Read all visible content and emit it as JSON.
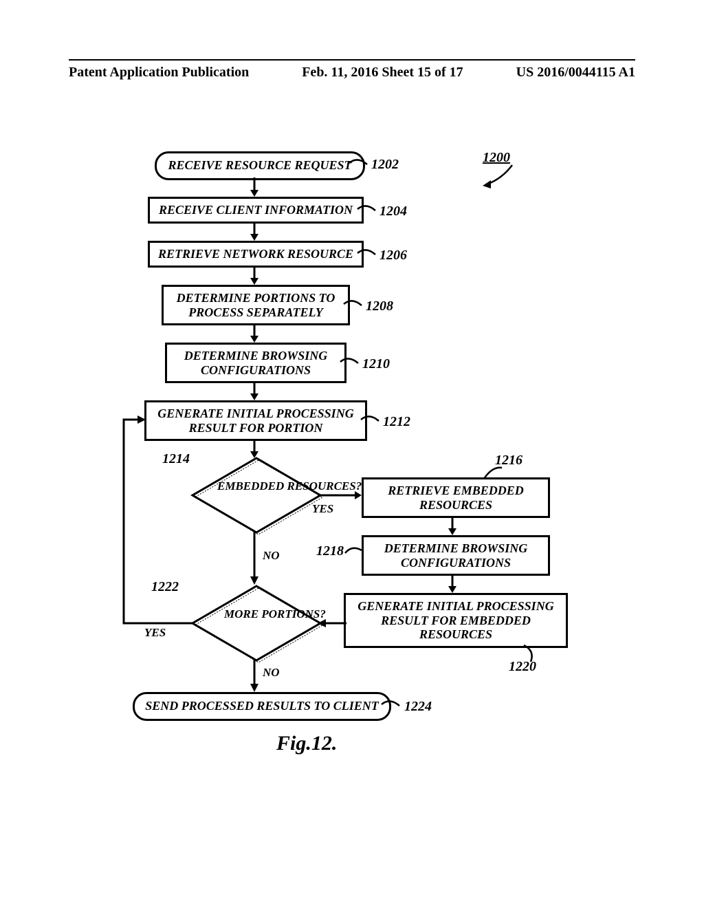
{
  "header": {
    "left": "Patent Application Publication",
    "center": "Feb. 11, 2016  Sheet 15 of 17",
    "right": "US 2016/0044115 A1"
  },
  "figure_label": "Fig.12.",
  "overall_ref": "1200",
  "steps": {
    "s1202": "RECEIVE RESOURCE REQUEST",
    "s1204": "RECEIVE CLIENT INFORMATION",
    "s1206": "RETRIEVE NETWORK RESOURCE",
    "s1208": "DETERMINE PORTIONS TO PROCESS SEPARATELY",
    "s1210": "DETERMINE BROWSING CONFIGURATIONS",
    "s1212": "GENERATE INITIAL PROCESSING RESULT FOR PORTION",
    "d1214": "EMBEDDED RESOURCES?",
    "s1216": "RETRIEVE EMBEDDED RESOURCES",
    "s1218": "DETERMINE BROWSING CONFIGURATIONS",
    "s1220": "GENERATE INITIAL PROCESSING RESULT FOR EMBEDDED RESOURCES",
    "d1222": "MORE PORTIONS?",
    "s1224": "SEND PROCESSED RESULTS TO CLIENT"
  },
  "edge": {
    "yes": "YES",
    "no": "NO"
  },
  "refs": {
    "r1202": "1202",
    "r1204": "1204",
    "r1206": "1206",
    "r1208": "1208",
    "r1210": "1210",
    "r1212": "1212",
    "r1214": "1214",
    "r1216": "1216",
    "r1218": "1218",
    "r1220": "1220",
    "r1222": "1222",
    "r1224": "1224"
  },
  "chart_data": {
    "type": "flowchart",
    "title": "Fig.12.",
    "nodes": [
      {
        "id": "1200",
        "shape": "reference",
        "text": "1200"
      },
      {
        "id": "1202",
        "shape": "terminator",
        "text": "RECEIVE RESOURCE REQUEST"
      },
      {
        "id": "1204",
        "shape": "process",
        "text": "RECEIVE CLIENT INFORMATION"
      },
      {
        "id": "1206",
        "shape": "process",
        "text": "RETRIEVE NETWORK RESOURCE"
      },
      {
        "id": "1208",
        "shape": "process",
        "text": "DETERMINE PORTIONS TO PROCESS SEPARATELY"
      },
      {
        "id": "1210",
        "shape": "process",
        "text": "DETERMINE BROWSING CONFIGURATIONS"
      },
      {
        "id": "1212",
        "shape": "process",
        "text": "GENERATE INITIAL PROCESSING RESULT FOR PORTION"
      },
      {
        "id": "1214",
        "shape": "decision",
        "text": "EMBEDDED RESOURCES?"
      },
      {
        "id": "1216",
        "shape": "process",
        "text": "RETRIEVE EMBEDDED RESOURCES"
      },
      {
        "id": "1218",
        "shape": "process",
        "text": "DETERMINE BROWSING CONFIGURATIONS"
      },
      {
        "id": "1220",
        "shape": "process",
        "text": "GENERATE INITIAL PROCESSING RESULT FOR EMBEDDED RESOURCES"
      },
      {
        "id": "1222",
        "shape": "decision",
        "text": "MORE PORTIONS?"
      },
      {
        "id": "1224",
        "shape": "terminator",
        "text": "SEND PROCESSED RESULTS TO CLIENT"
      }
    ],
    "edges": [
      {
        "from": "1202",
        "to": "1204"
      },
      {
        "from": "1204",
        "to": "1206"
      },
      {
        "from": "1206",
        "to": "1208"
      },
      {
        "from": "1208",
        "to": "1210"
      },
      {
        "from": "1210",
        "to": "1212"
      },
      {
        "from": "1212",
        "to": "1214"
      },
      {
        "from": "1214",
        "to": "1216",
        "label": "YES"
      },
      {
        "from": "1216",
        "to": "1218"
      },
      {
        "from": "1218",
        "to": "1220"
      },
      {
        "from": "1220",
        "to": "1222"
      },
      {
        "from": "1214",
        "to": "1222",
        "label": "NO"
      },
      {
        "from": "1222",
        "to": "1212",
        "label": "YES"
      },
      {
        "from": "1222",
        "to": "1224",
        "label": "NO"
      }
    ]
  }
}
